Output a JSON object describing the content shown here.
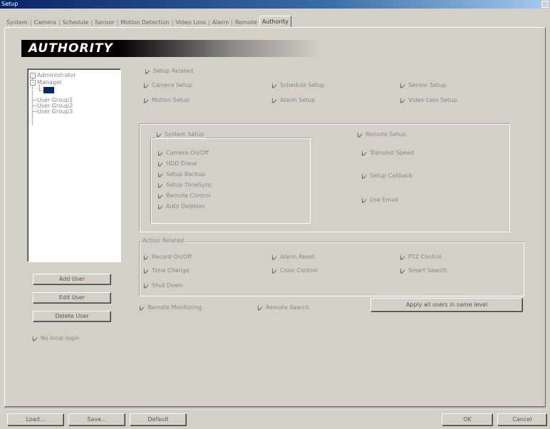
{
  "window": {
    "title": "Setup"
  },
  "tabs": [
    "System",
    "Camera",
    "Schedule",
    "Sensor",
    "Motion Detection",
    "Video Loss",
    "Alarm",
    "Remote",
    "Authority"
  ],
  "active_tab": "Authority",
  "section_title": "AUTHORITY",
  "tree": {
    "items": [
      "Administrator",
      "Manager",
      "---",
      "User Group1",
      "User Group2",
      "User Group3"
    ],
    "selected_index": 2
  },
  "buttons": {
    "add_user": "Add User",
    "edit_user": "Edit User",
    "delete_user": "Delete User",
    "apply_all": "Apply all users in same level",
    "load": "Load...",
    "save": "Save...",
    "default": "Default",
    "ok": "OK",
    "cancel": "Cancel"
  },
  "no_local_login": {
    "label": "No local login",
    "checked": true
  },
  "setup_related": {
    "label": "Setup Related",
    "items": [
      {
        "label": "Camera Setup",
        "checked": true
      },
      {
        "label": "Schedule Setup",
        "checked": true
      },
      {
        "label": "Sensor Setup",
        "checked": true
      },
      {
        "label": "Motion Setup",
        "checked": true
      },
      {
        "label": "Alarm Setup",
        "checked": true
      },
      {
        "label": "Video Loss Setup",
        "checked": true
      }
    ],
    "system_setup": {
      "label": "System Setup",
      "items": [
        {
          "label": "Camera On/Off",
          "checked": true
        },
        {
          "label": "HDD Erase",
          "checked": true
        },
        {
          "label": "Setup Backup",
          "checked": true
        },
        {
          "label": "Setup TimeSync",
          "checked": true
        },
        {
          "label": "Remote Control",
          "checked": true
        },
        {
          "label": "Auto Deletion",
          "checked": true
        }
      ]
    },
    "remote_setup": {
      "label": "Remote Setup",
      "items": [
        {
          "label": "Transmit Speed",
          "checked": true
        },
        {
          "label": "Setup Callback",
          "checked": true
        },
        {
          "label": "Use Email",
          "checked": true
        }
      ]
    }
  },
  "action_related": {
    "label": "Action Related",
    "items": [
      {
        "label": "Record On/Off",
        "checked": true
      },
      {
        "label": "Alarm Reset",
        "checked": true
      },
      {
        "label": "PTZ Control",
        "checked": true
      },
      {
        "label": "Time Change",
        "checked": true
      },
      {
        "label": "Color Control",
        "checked": true
      },
      {
        "label": "Smart Search",
        "checked": true
      },
      {
        "label": "Shut Down",
        "checked": true
      }
    ]
  },
  "remote_monitoring": {
    "label": "Remote Monitoring",
    "checked": true
  },
  "remote_search": {
    "label": "Remote Search",
    "checked": true
  }
}
